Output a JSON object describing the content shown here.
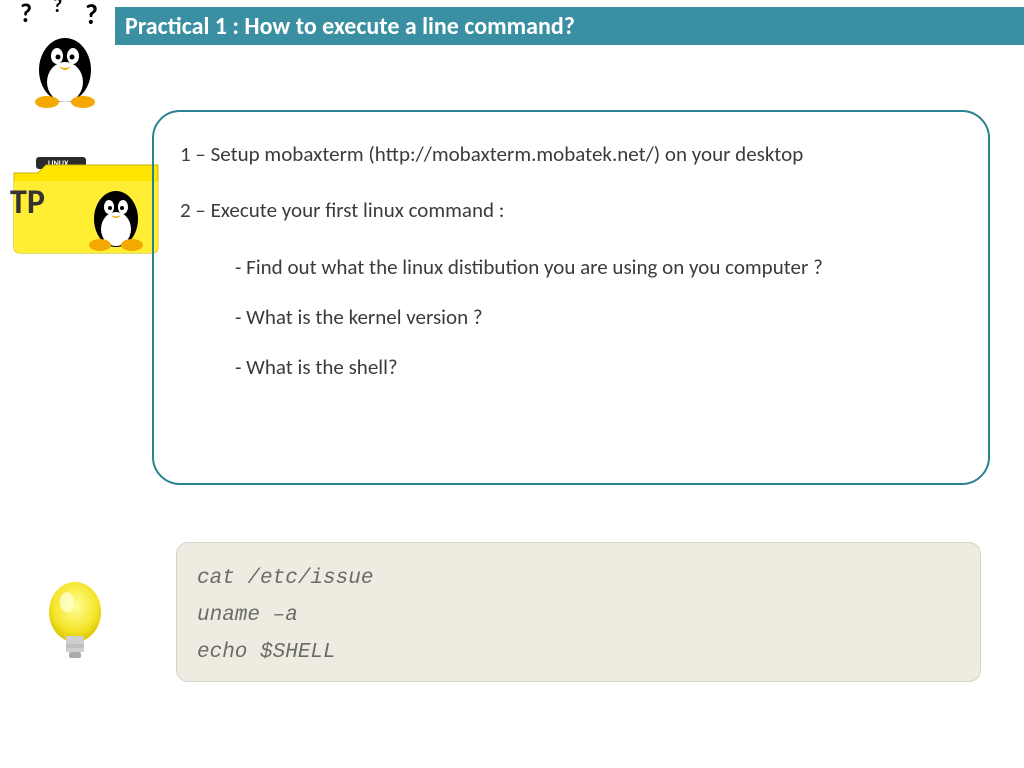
{
  "title": "Practical 1 : How to execute a line command?",
  "content": {
    "step1": "1 – Setup mobaxterm (http://mobaxterm.mobatek.net/) on your desktop",
    "step2": "2 – Execute your first linux command :",
    "sub1": "- Find out what the linux distibution you are using on you computer ?",
    "sub2": "- What is the kernel version ?",
    "sub3": "- What  is the shell?"
  },
  "hints": {
    "line1": "cat /etc/issue",
    "line2": "uname –a",
    "line3": "echo $SHELL"
  },
  "icons": {
    "tux_quest": "tux-question-icon",
    "tp_folder": "tp-linux-folder-icon",
    "bulb": "lightbulb-icon"
  }
}
